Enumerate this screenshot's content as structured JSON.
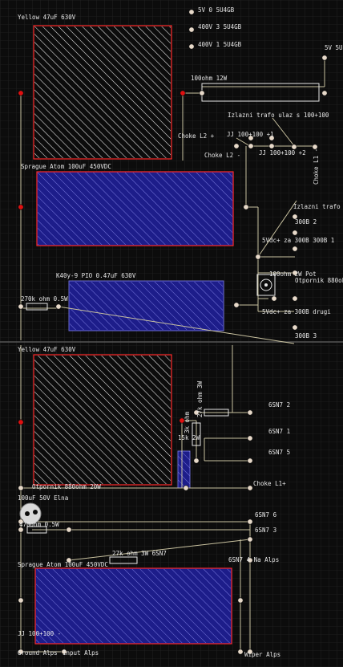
{
  "title": "",
  "colors": {
    "background": "#0c0c0c",
    "grid": "#2a2a2a",
    "cap_large_outline": "#ff2a2a",
    "cap_blue_fill": "#1d1d8a",
    "hatch": "#f0f0f0",
    "wire": "#c9c2a0",
    "pad": "#e7d9c9",
    "pad_red": "#e01010"
  },
  "labels": {
    "yellow_top": "Yellow 47uF 630V",
    "tube_5v0": "5V 0 5U4GB",
    "tube_400v3": "400V 3 5U4GB",
    "tube_400v1": "400V 1 5U4GB",
    "tube_5v_right": "5V 5U",
    "res_100ohm": "100ohm 12W",
    "izlazni_ulaz": "Izlazni trafo ulaz s 100+100",
    "choke_l2_plus": "Choke L2 +",
    "jj_plus1": "JJ 100+100 +1",
    "choke_l2_minus": "Choke L2 -",
    "jj_plus2": "JJ 100+100 +2",
    "choke_l1_minus": "Choke L1 -",
    "sprague_top": "Sprague Atom 100uF 450VDC",
    "izlazni_trafo": "Izlazni trafo",
    "b300_2": "300B 2",
    "vdc_300b": "5Vdc+ za 300B 300B 1",
    "res_100ohm_2w": "100ohm 2W Pot",
    "otpornik_880": "Otpornik 880oh",
    "k40": "K40y-9 PIO 0.47uF 630V",
    "res_270k": "270k ohm 0.5W",
    "vdc_300b_drugi": "5Vdc+ za 300B drugi",
    "b300_3": "300B 3",
    "yellow_bottom": "Yellow 47uF 630V",
    "res_27k": "27k ohm 3W",
    "sn7_2": "6SN7 2",
    "sn7_1": "6SN7 1",
    "res_15k": "15k 2W",
    "res_3k": "3k ohm",
    "sn7_5": "6SN7 5",
    "otpornik_880_20w": "Otpornik 880ohm 20W",
    "choke_l1_plus": "Choke L1+",
    "elna": "100uF 50V Elna",
    "sn7_6": "6SN7 6",
    "res_470": "470ohm 0.5W",
    "sn7_3": "6SN7 3",
    "res_27k_6sn7": "27k ohm 3W 6SN7",
    "sn7_4": "6SN7 4 Na Alps",
    "sprague_bottom": "Sprague Atom 100uF 450VDC",
    "jj_minus": "JJ 100+100 -",
    "ground_alps": "Ground Alps",
    "input_alps": "Input Alps",
    "wiper_alps": "Wiper Alps"
  }
}
